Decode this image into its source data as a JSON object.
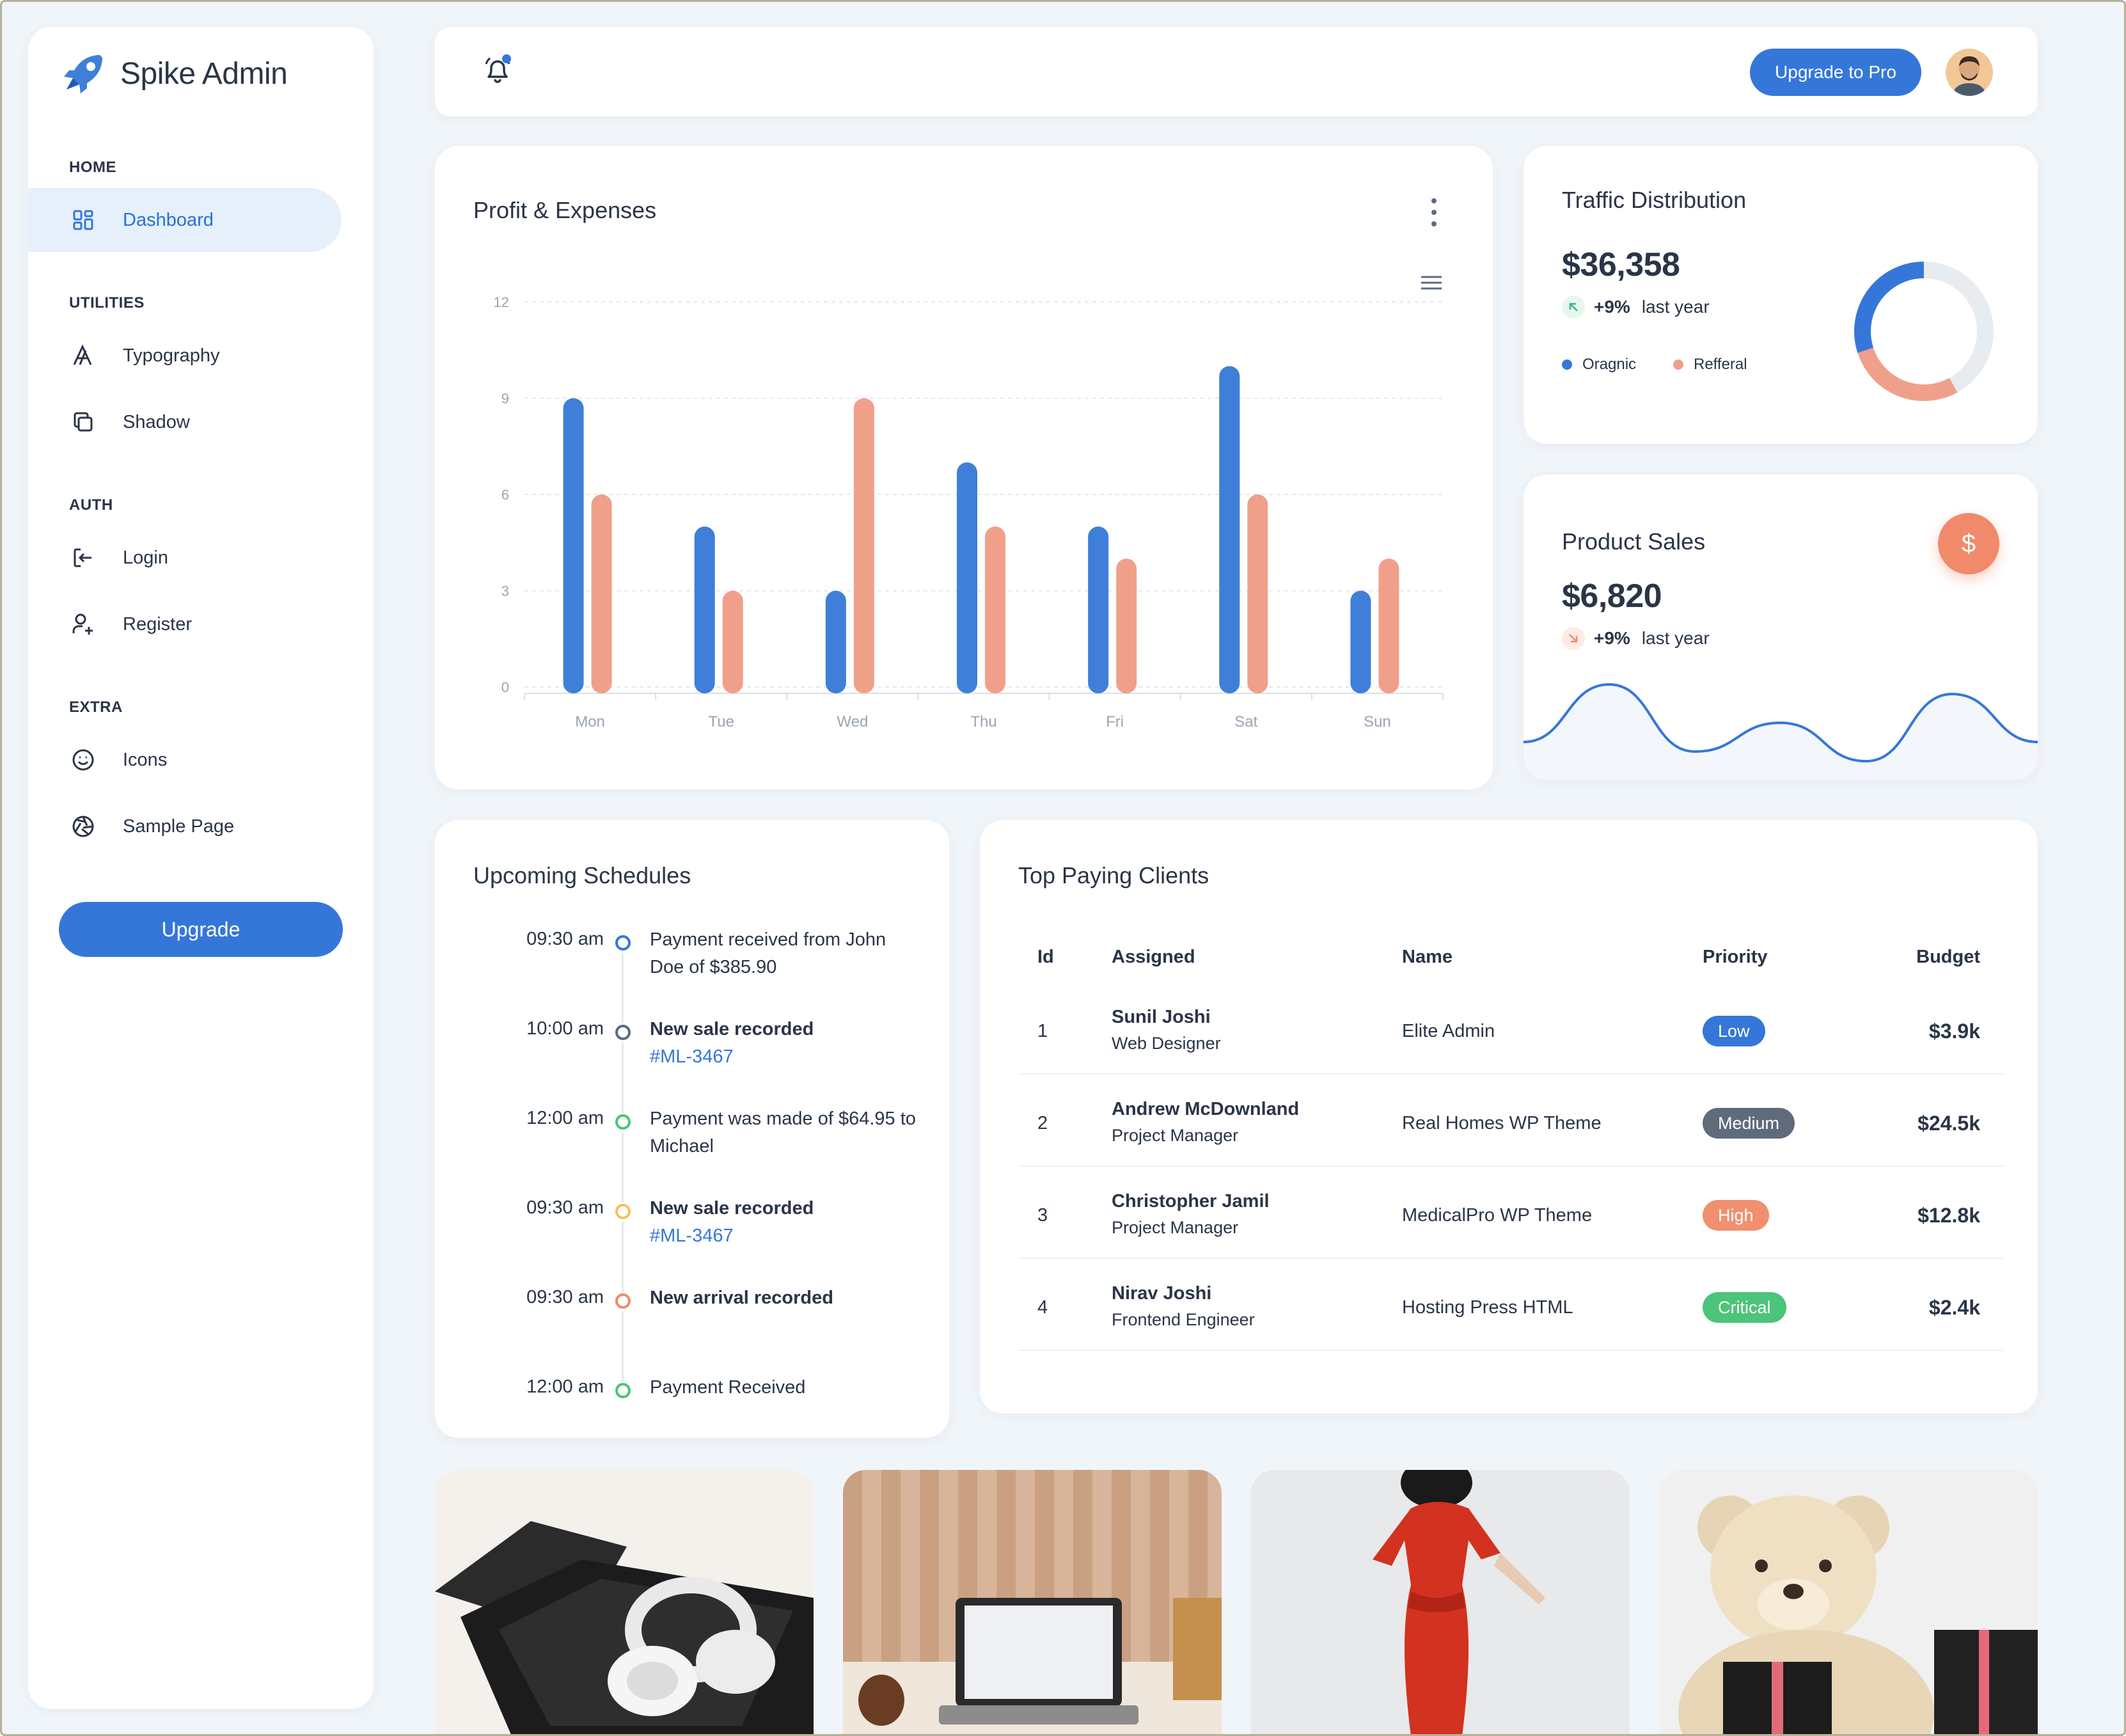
{
  "brand": {
    "name": "Spike Admin"
  },
  "sidebar": {
    "sections": [
      {
        "title": "HOME"
      },
      {
        "title": "UTILITIES"
      },
      {
        "title": "AUTH"
      },
      {
        "title": "EXTRA"
      }
    ],
    "items": [
      {
        "label": "Dashboard",
        "icon": "dashboard-grid-icon",
        "active": true
      },
      {
        "label": "Typography",
        "icon": "typography-icon"
      },
      {
        "label": "Shadow",
        "icon": "copy-shadow-icon"
      },
      {
        "label": "Login",
        "icon": "login-icon"
      },
      {
        "label": "Register",
        "icon": "user-plus-icon"
      },
      {
        "label": "Icons",
        "icon": "mood-smile-icon"
      },
      {
        "label": "Sample Page",
        "icon": "aperture-icon"
      }
    ],
    "upgrade_label": "Upgrade"
  },
  "header": {
    "upgrade_pro_label": "Upgrade to Pro",
    "notification_icon": "bell-icon",
    "avatar_icon": "user-avatar"
  },
  "profit": {
    "title": "Profit & Expenses",
    "menu_icon": "dots-vertical-icon",
    "chart_menu_icon": "hamburger-menu-icon"
  },
  "chart_data": [
    {
      "type": "bar",
      "title": "Profit & Expenses",
      "categories": [
        "Mon",
        "Tue",
        "Wed",
        "Thu",
        "Fri",
        "Sat",
        "Sun"
      ],
      "series": [
        {
          "color": "#3f7fd9",
          "values": [
            9,
            5,
            3,
            7,
            5,
            10,
            3
          ]
        },
        {
          "color": "#f0a08a",
          "values": [
            6,
            3,
            9,
            5,
            4,
            6,
            4
          ]
        }
      ],
      "yticks": [
        "0",
        "3",
        "6",
        "9",
        "12"
      ],
      "ylim": [
        0,
        12
      ],
      "grid": true
    },
    {
      "type": "pie",
      "title": "Traffic Distribution",
      "series": [
        {
          "name": "Oragnic",
          "color": "#3577d9",
          "value": 30
        },
        {
          "name": "Refferal",
          "color": "#f0a08a",
          "value": 28
        },
        {
          "name": "",
          "color": "#e7ecf1",
          "value": 42
        }
      ]
    },
    {
      "type": "area",
      "title": "Product Sales",
      "values": [
        30,
        60,
        25,
        40,
        20,
        55,
        30
      ],
      "color": "#3577d9"
    }
  ],
  "traffic": {
    "title": "Traffic Distribution",
    "amount": "$36,358",
    "pct": "+9%",
    "period": "last year",
    "legend": [
      {
        "label": "Oragnic",
        "color": "#3577d9"
      },
      {
        "label": "Refferal",
        "color": "#f0a08a"
      }
    ]
  },
  "sales": {
    "title": "Product Sales",
    "amount": "$6,820",
    "pct": "+9%",
    "period": "last year",
    "icon": "dollar-icon"
  },
  "schedules": {
    "title": "Upcoming Schedules",
    "items": [
      {
        "time": "09:30 am",
        "text": "Payment received from John Doe of $385.90",
        "bold": false,
        "link": "",
        "color": "#3577d9"
      },
      {
        "time": "10:00 am",
        "text": "New sale recorded",
        "bold": true,
        "link": "#ML-3467",
        "color": "#5a6a85"
      },
      {
        "time": "12:00 am",
        "text": "Payment was made of $64.95 to Michael",
        "bold": false,
        "link": "",
        "color": "#4cc479"
      },
      {
        "time": "09:30 am",
        "text": "New sale recorded",
        "bold": true,
        "link": "#ML-3467",
        "color": "#f2c25a"
      },
      {
        "time": "09:30 am",
        "text": "New arrival recorded",
        "bold": true,
        "link": "",
        "color": "#f08a6a"
      },
      {
        "time": "12:00 am",
        "text": "Payment Received",
        "bold": false,
        "link": "",
        "color": "#4cc479"
      }
    ]
  },
  "clients": {
    "title": "Top Paying Clients",
    "headers": {
      "id": "Id",
      "assigned": "Assigned",
      "name": "Name",
      "priority": "Priority",
      "budget": "Budget"
    },
    "rows": [
      {
        "id": "1",
        "person": "Sunil Joshi",
        "role": "Web Designer",
        "project": "Elite Admin",
        "priority": "Low",
        "priority_color": "#3577d9",
        "budget": "$3.9k"
      },
      {
        "id": "2",
        "person": "Andrew McDownland",
        "role": "Project Manager",
        "project": "Real Homes WP Theme",
        "priority": "Medium",
        "priority_color": "#5f6b7a",
        "budget": "$24.5k"
      },
      {
        "id": "3",
        "person": "Christopher Jamil",
        "role": "Project Manager",
        "project": "MedicalPro WP Theme",
        "priority": "High",
        "priority_color": "#f0906e",
        "budget": "$12.8k"
      },
      {
        "id": "4",
        "person": "Nirav Joshi",
        "role": "Frontend Engineer",
        "project": "Hosting Press HTML",
        "priority": "Critical",
        "priority_color": "#4cc479",
        "budget": "$2.4k"
      }
    ]
  },
  "products": [
    {
      "name": "headphones-case-image"
    },
    {
      "name": "laptop-desk-image"
    },
    {
      "name": "red-dress-image"
    },
    {
      "name": "teddy-bear-image"
    }
  ]
}
